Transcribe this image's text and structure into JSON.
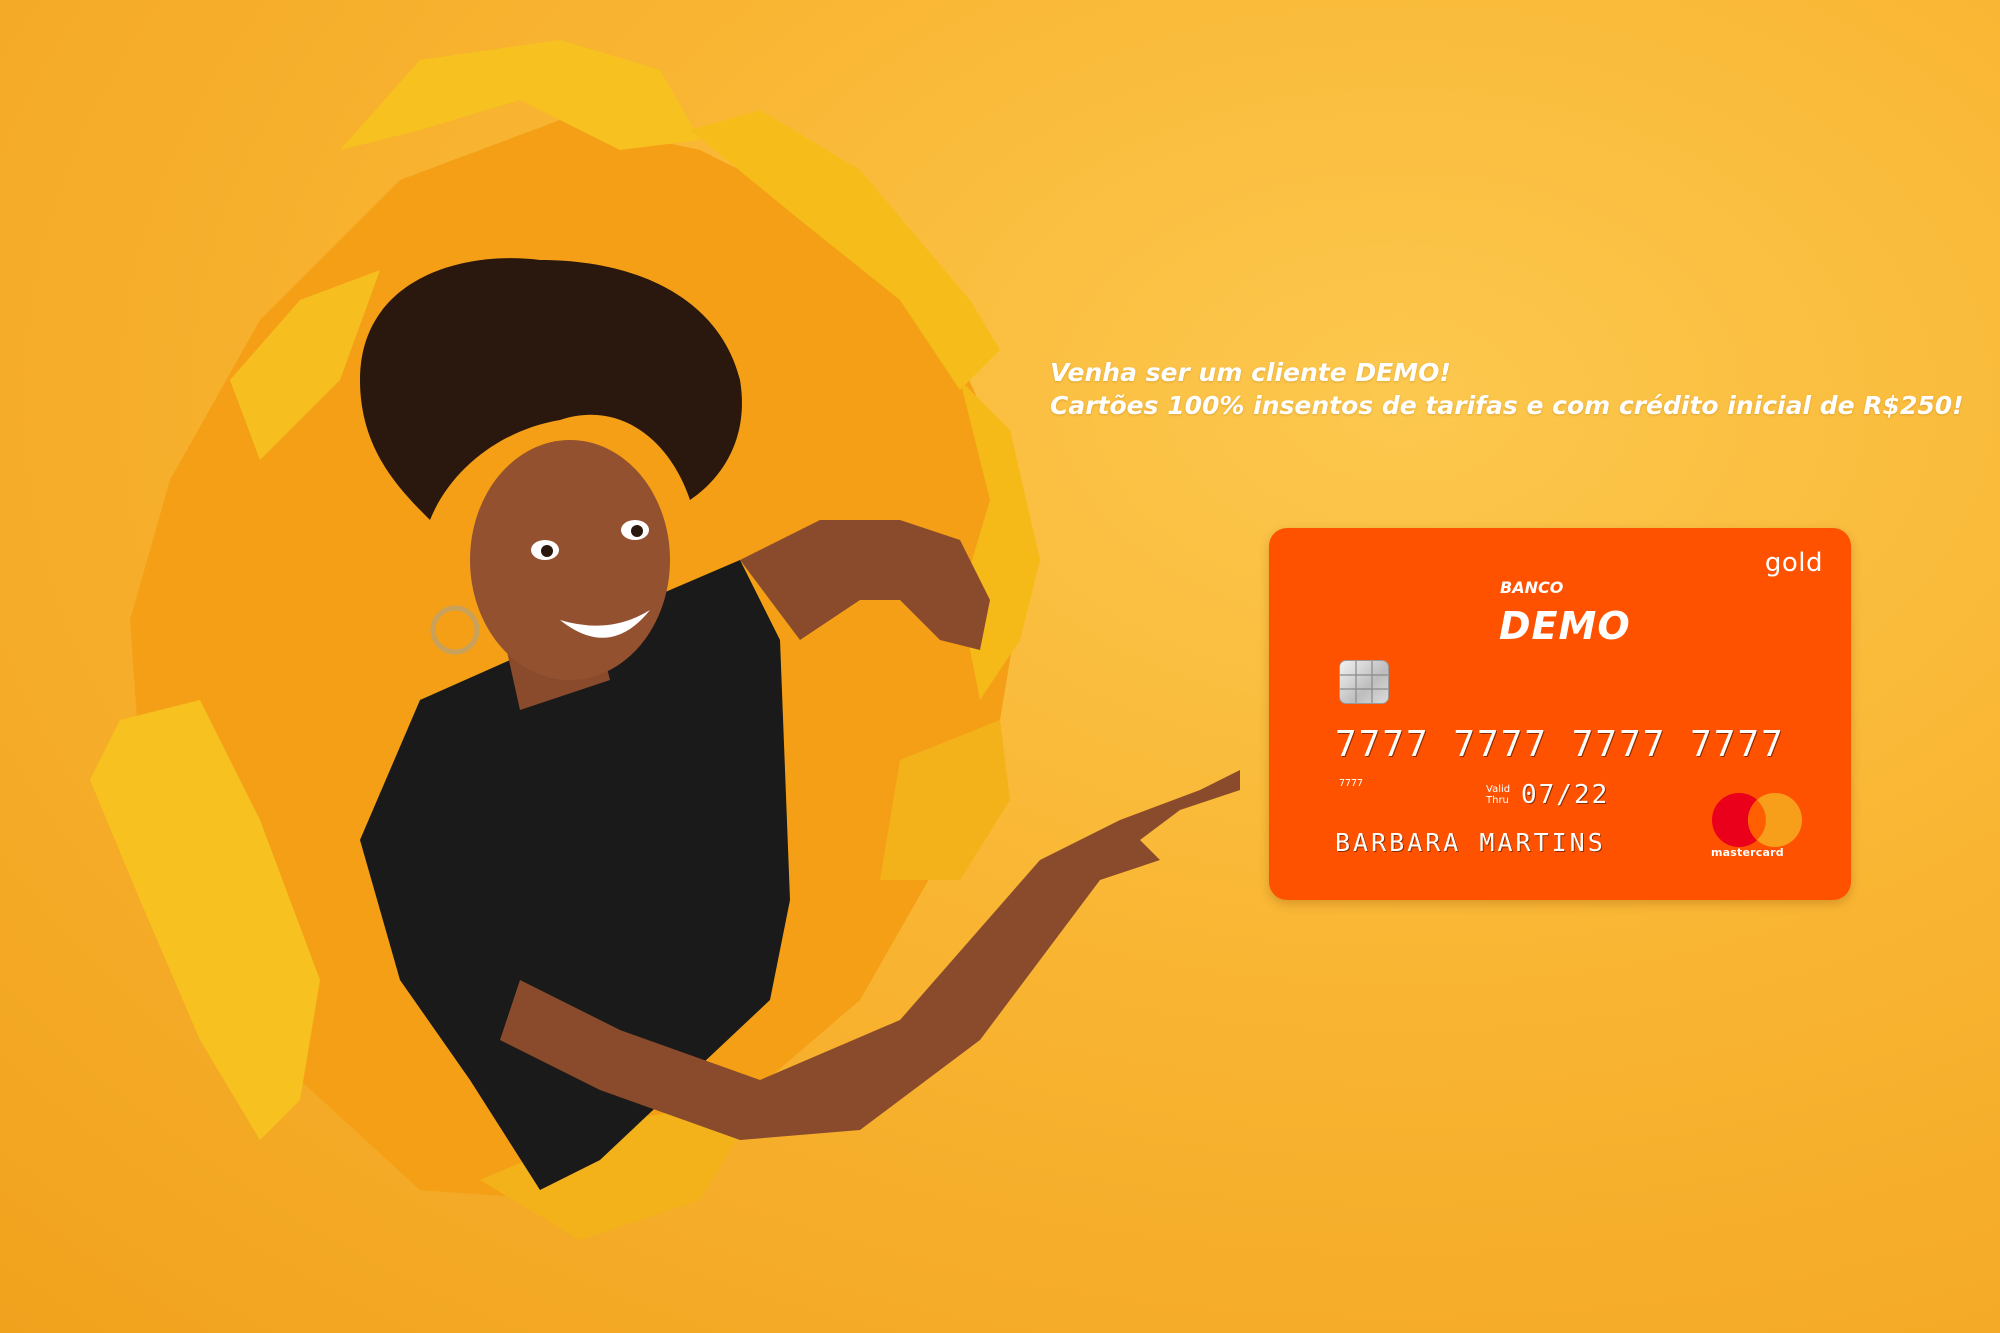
{
  "promo": {
    "line1": "Venha ser um cliente DEMO!",
    "line2": "Cartões 100% insentos de tarifas e com crédito inicial de R$250!"
  },
  "card": {
    "tier": "gold",
    "bank_label": "BANCO",
    "bank_name": "DEMO",
    "number": "7777 7777 7777 7777",
    "small_number": "7777",
    "valid_label_1": "Valid",
    "valid_label_2": "Thru",
    "expiry": "07/22",
    "holder": "BARBARA MARTINS",
    "network": "mastercard",
    "color": "#ff5200"
  },
  "colors": {
    "background": "#f9b532",
    "hole": "#f49f16",
    "paper_edge": "#f7c21f"
  }
}
